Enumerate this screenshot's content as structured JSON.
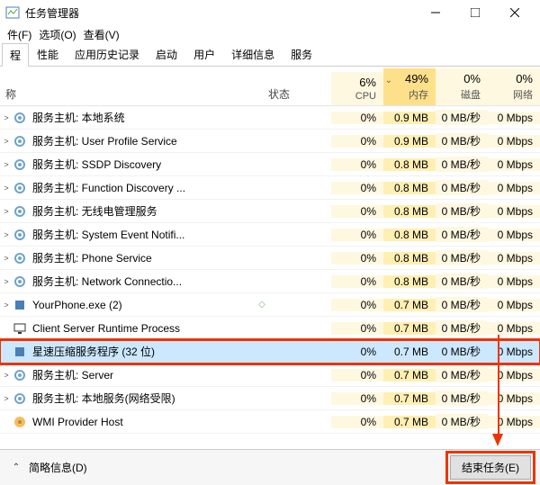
{
  "window": {
    "title": "任务管理器"
  },
  "menu": {
    "file": "件(F)",
    "options": "选项(O)",
    "view": "查看(V)"
  },
  "tabs": {
    "processes": "程",
    "performance": "性能",
    "history": "应用历史记录",
    "startup": "启动",
    "users": "用户",
    "details": "详细信息",
    "services": "服务"
  },
  "columns": {
    "name": "称",
    "status": "状态",
    "cpu_pct": "6%",
    "cpu_label": "CPU",
    "mem_pct": "49%",
    "mem_label": "内存",
    "disk_pct": "0%",
    "disk_label": "磁盘",
    "net_pct": "0%",
    "net_label": "网络"
  },
  "rows": [
    {
      "icon": "gear",
      "name": "服务主机: 本地系统",
      "expand": true,
      "cpu": "0%",
      "mem": "0.9 MB",
      "disk": "0 MB/秒",
      "net": "0 Mbps"
    },
    {
      "icon": "gear",
      "name": "服务主机: User Profile Service",
      "expand": true,
      "cpu": "0%",
      "mem": "0.9 MB",
      "disk": "0 MB/秒",
      "net": "0 Mbps"
    },
    {
      "icon": "gear",
      "name": "服务主机: SSDP Discovery",
      "expand": true,
      "cpu": "0%",
      "mem": "0.8 MB",
      "disk": "0 MB/秒",
      "net": "0 Mbps"
    },
    {
      "icon": "gear",
      "name": "服务主机: Function Discovery ...",
      "expand": true,
      "cpu": "0%",
      "mem": "0.8 MB",
      "disk": "0 MB/秒",
      "net": "0 Mbps"
    },
    {
      "icon": "gear",
      "name": "服务主机: 无线电管理服务",
      "expand": true,
      "cpu": "0%",
      "mem": "0.8 MB",
      "disk": "0 MB/秒",
      "net": "0 Mbps"
    },
    {
      "icon": "gear",
      "name": "服务主机: System Event Notifi...",
      "expand": true,
      "cpu": "0%",
      "mem": "0.8 MB",
      "disk": "0 MB/秒",
      "net": "0 Mbps"
    },
    {
      "icon": "gear",
      "name": "服务主机: Phone Service",
      "expand": true,
      "cpu": "0%",
      "mem": "0.8 MB",
      "disk": "0 MB/秒",
      "net": "0 Mbps"
    },
    {
      "icon": "gear",
      "name": "服务主机: Network Connectio...",
      "expand": true,
      "cpu": "0%",
      "mem": "0.8 MB",
      "disk": "0 MB/秒",
      "net": "0 Mbps"
    },
    {
      "icon": "cube",
      "name": "YourPhone.exe (2)",
      "expand": true,
      "leaf": true,
      "cpu": "0%",
      "mem": "0.7 MB",
      "disk": "0 MB/秒",
      "net": "0 Mbps"
    },
    {
      "icon": "mon",
      "name": "Client Server Runtime Process",
      "expand": false,
      "cpu": "0%",
      "mem": "0.7 MB",
      "disk": "0 MB/秒",
      "net": "0 Mbps"
    },
    {
      "icon": "cube",
      "name": "星速压缩服务程序 (32 位)",
      "expand": false,
      "selected": true,
      "redbox": true,
      "cpu": "0%",
      "mem": "0.7 MB",
      "disk": "0 MB/秒",
      "net": "0 Mbps"
    },
    {
      "icon": "gear",
      "name": "服务主机: Server",
      "expand": true,
      "cpu": "0%",
      "mem": "0.7 MB",
      "disk": "0 MB/秒",
      "net": "0 Mbps"
    },
    {
      "icon": "gear",
      "name": "服务主机: 本地服务(网络受限)",
      "expand": true,
      "cpu": "0%",
      "mem": "0.7 MB",
      "disk": "0 MB/秒",
      "net": "0 Mbps"
    },
    {
      "icon": "wmi",
      "name": "WMI Provider Host",
      "expand": false,
      "cpu": "0%",
      "mem": "0.7 MB",
      "disk": "0 MB/秒",
      "net": "0 Mbps"
    }
  ],
  "footer": {
    "brief": "简略信息(D)",
    "end_task": "结束任务(E)"
  }
}
